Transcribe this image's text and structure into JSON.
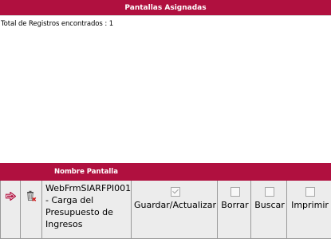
{
  "header": {
    "title": "Pantallas Asignadas"
  },
  "summary": {
    "total_text": "Total de Registros encontrados : 1"
  },
  "grid": {
    "column_header": "Nombre Pantalla",
    "rows": [
      {
        "name_lines": [
          "WebFrmSIARFPI001",
          "- Carga del",
          "Presupuesto de",
          "Ingresos"
        ],
        "permissions": [
          {
            "label": "Guardar/Actualizar",
            "checked": true
          },
          {
            "label": "Borrar",
            "checked": false
          },
          {
            "label": "Buscar",
            "checked": false
          },
          {
            "label": "Imprimir",
            "checked": false
          }
        ]
      }
    ]
  },
  "colors": {
    "accent": "#b0103f",
    "row_bg": "#ececec"
  },
  "icons": {
    "select": "arrow-right-icon",
    "delete": "trash-delete-icon"
  }
}
